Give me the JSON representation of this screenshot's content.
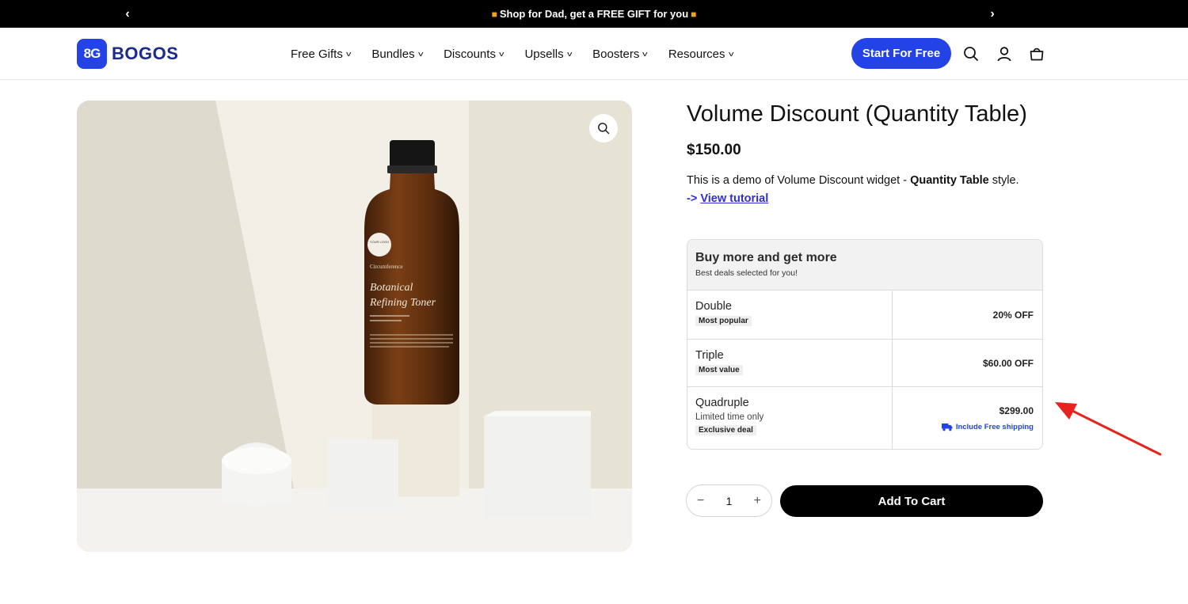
{
  "announcement": {
    "text": "Shop for Dad, get a FREE GIFT for you",
    "gift_icon": "gift-icon",
    "prev_icon": "chevron-left-icon",
    "next_icon": "chevron-right-icon"
  },
  "header": {
    "logo_mark": "8G",
    "logo_text": "BOGOS",
    "nav": [
      {
        "label": "Free Gifts"
      },
      {
        "label": "Bundles"
      },
      {
        "label": "Discounts"
      },
      {
        "label": "Upsells"
      },
      {
        "label": "Boosters"
      },
      {
        "label": "Resources"
      }
    ],
    "cta_label": "Start For Free",
    "icons": [
      "search-icon",
      "account-icon",
      "cart-icon"
    ],
    "brand_color": "#2443e6"
  },
  "product": {
    "image": {
      "bottle_label_logo": "YOUR LOGO",
      "bottle_label_brand": "Circumference",
      "bottle_label_name_1": "Botanical",
      "bottle_label_name_2": "Refining Toner"
    },
    "title": "Volume Discount (Quantity Table)",
    "price": "$150.00",
    "description_prefix": "This is a demo of Volume Discount widget - ",
    "description_bold": "Quantity Table",
    "description_suffix": " style.",
    "tutorial_arrow": "->",
    "tutorial_link": "View tutorial"
  },
  "quantity_table": {
    "heading": "Buy more and get more",
    "subheading": "Best deals selected for you!",
    "rows": [
      {
        "name": "Double",
        "sub": "",
        "badge": "Most popular",
        "value": "20% OFF",
        "extra": ""
      },
      {
        "name": "Triple",
        "sub": "",
        "badge": "Most value",
        "value": "$60.00 OFF",
        "extra": ""
      },
      {
        "name": "Quadruple",
        "sub": "Limited time only",
        "badge": "Exclusive deal",
        "value": "$299.00",
        "extra": "Include Free shipping"
      }
    ]
  },
  "purchase": {
    "quantity": "1",
    "minus": "−",
    "plus": "+",
    "add_to_cart": "Add To Cart"
  },
  "annotation": {
    "arrow_color": "#e8231f"
  }
}
